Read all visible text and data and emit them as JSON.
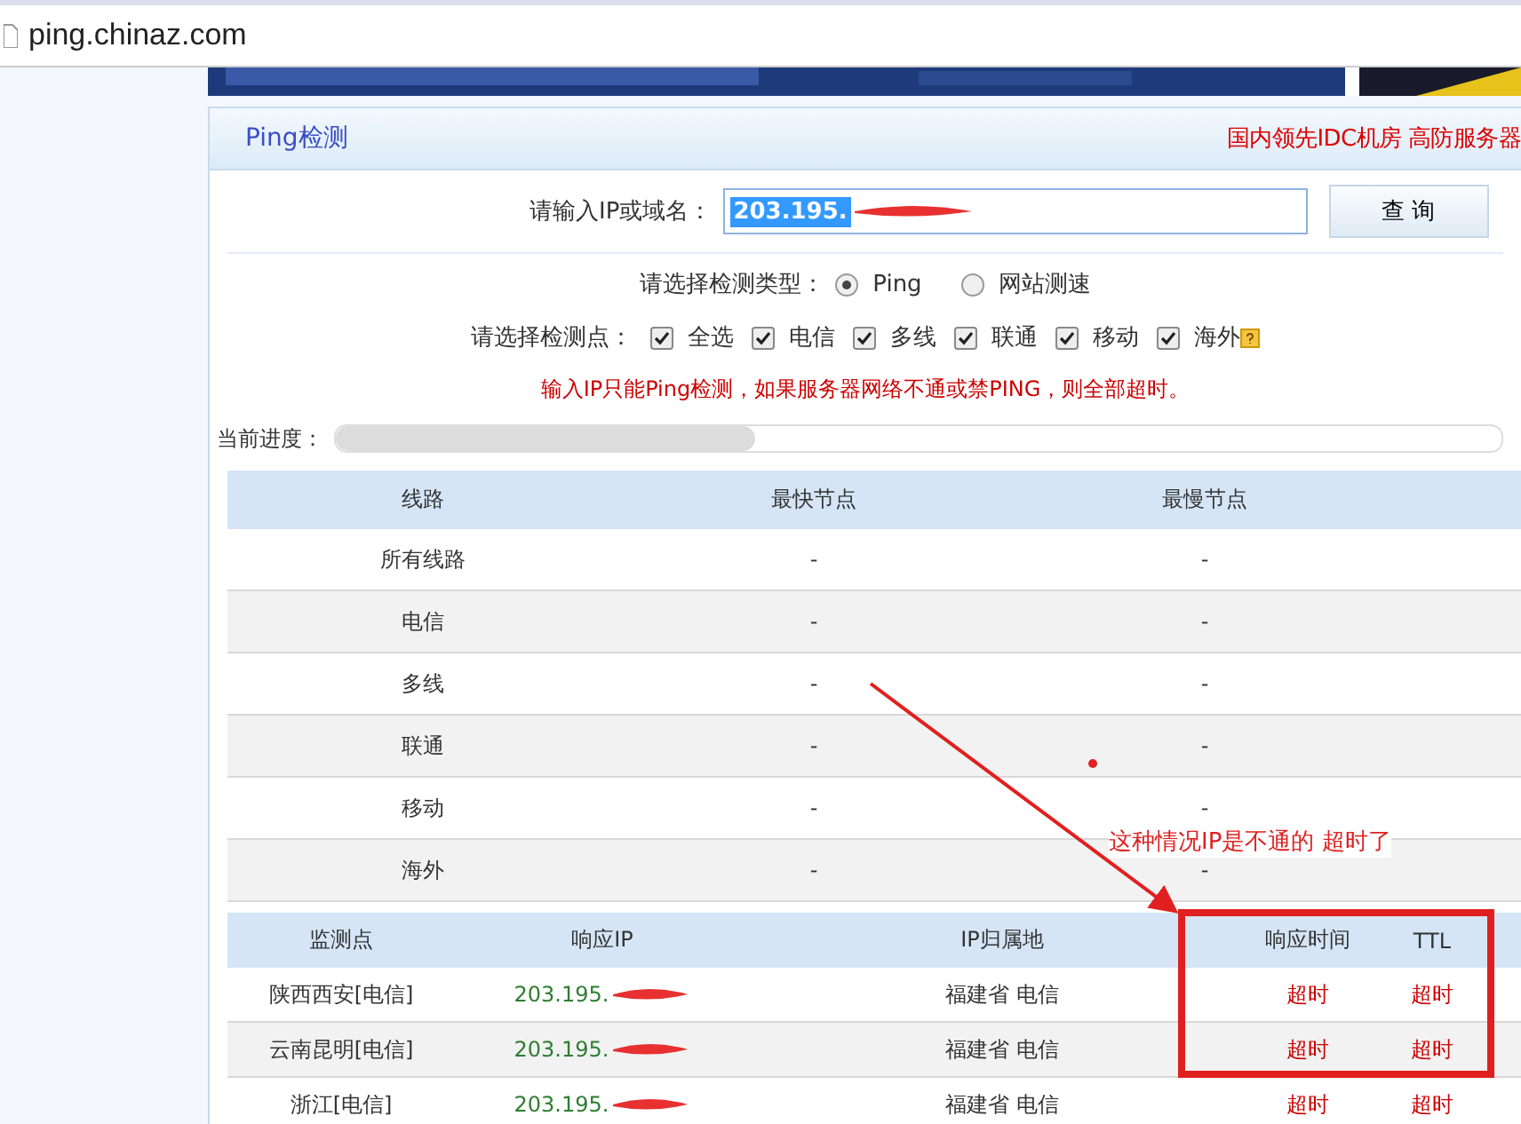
{
  "address_bar": {
    "url": "ping.chinaz.com"
  },
  "panel": {
    "title": "Ping检测",
    "promo": "国内领先IDC机房 高防服务器"
  },
  "query": {
    "label": "请输入IP或域名：",
    "value": "203.195.",
    "redacted": true,
    "button": "查 询"
  },
  "test_type": {
    "label": "请选择检测类型：",
    "options": [
      {
        "label": "Ping",
        "selected": true
      },
      {
        "label": "网站测速",
        "selected": false
      }
    ]
  },
  "test_points": {
    "label": "请选择检测点：",
    "options": [
      {
        "label": "全选",
        "checked": true
      },
      {
        "label": "电信",
        "checked": true
      },
      {
        "label": "多线",
        "checked": true
      },
      {
        "label": "联通",
        "checked": true
      },
      {
        "label": "移动",
        "checked": true
      },
      {
        "label": "海外",
        "checked": true,
        "help": true
      }
    ]
  },
  "notice": "输入IP只能Ping检测，如果服务器网络不通或禁PING，则全部超时。",
  "progress": {
    "label": "当前进度：",
    "level": 0.36
  },
  "summary_table": {
    "columns": [
      "线路",
      "最快节点",
      "最慢节点"
    ],
    "rows": [
      [
        "所有线路",
        "-",
        "-"
      ],
      [
        "电信",
        "-",
        "-"
      ],
      [
        "多线",
        "-",
        "-"
      ],
      [
        "联通",
        "-",
        "-"
      ],
      [
        "移动",
        "-",
        "-"
      ],
      [
        "海外",
        "-",
        "-"
      ]
    ]
  },
  "result_table": {
    "columns": [
      "监测点",
      "响应IP",
      "IP归属地",
      "响应时间",
      "TTL"
    ],
    "rows": [
      {
        "node": "陕西西安[电信]",
        "ip": "203.195.",
        "redacted": true,
        "location": "福建省 电信",
        "time": "超时",
        "ttl": "超时"
      },
      {
        "node": "云南昆明[电信]",
        "ip": "203.195.",
        "redacted": true,
        "location": "福建省 电信",
        "time": "超时",
        "ttl": "超时"
      },
      {
        "node": "浙江[电信]",
        "ip": "203.195.",
        "redacted": true,
        "location": "福建省 电信",
        "time": "超时",
        "ttl": "超时"
      }
    ]
  },
  "annotation": {
    "text": "这种情况IP是不通的 超时了"
  }
}
